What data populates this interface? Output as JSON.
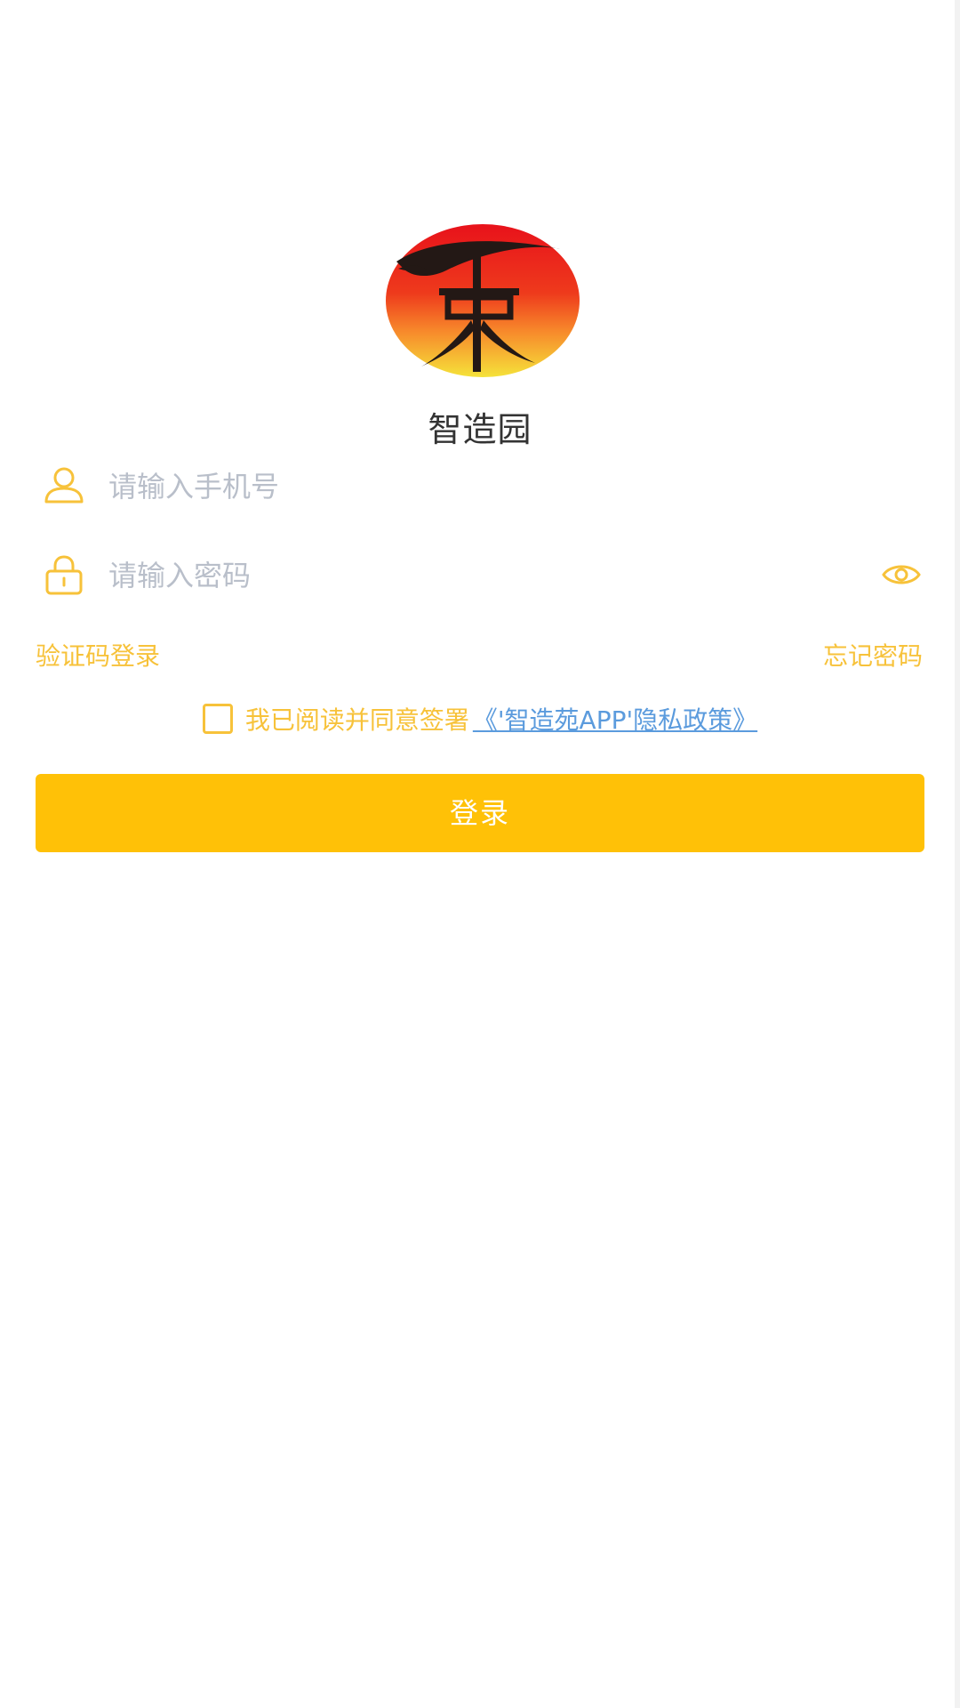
{
  "app": {
    "name": "智造园"
  },
  "form": {
    "phone_placeholder": "请输入手机号",
    "password_placeholder": "请输入密码"
  },
  "links": {
    "sms_login": "验证码登录",
    "forgot_password": "忘记密码"
  },
  "agreement": {
    "text": "我已阅读并同意签署",
    "policy_link": "《'智造苑APP'隐私政策》"
  },
  "buttons": {
    "login": "登录"
  },
  "colors": {
    "accent": "#ffc107",
    "link_yellow": "#f7c23a",
    "link_blue": "#5b9bdd",
    "placeholder": "#b9bfca"
  },
  "icons": {
    "phone_field": "user-icon",
    "password_field": "lock-icon",
    "password_toggle": "eye-icon"
  }
}
